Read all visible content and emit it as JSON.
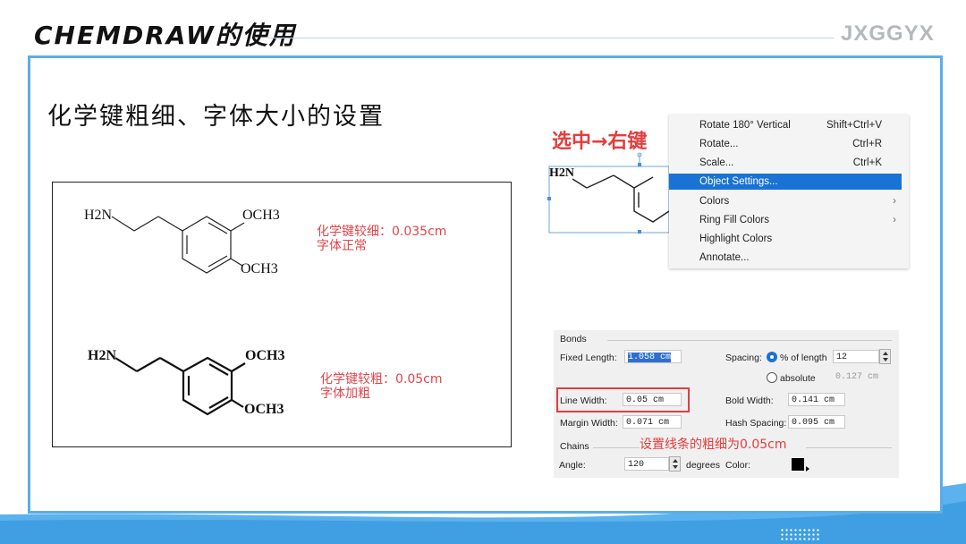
{
  "header": {
    "title": "CHEMDRAW的使用",
    "brand": "JXGGYX"
  },
  "slide": {
    "subtitle": "化学键粗细、字体大小的设置"
  },
  "molecules": {
    "top": {
      "amine": "H2N",
      "ome_upper": "OCH3",
      "ome_lower": "OCH3",
      "note_line1": "化学键较细：0.035cm",
      "note_line2": "字体正常"
    },
    "bottom": {
      "amine": "H2N",
      "ome_upper": "OCH3",
      "ome_lower": "OCH3",
      "note_line1": "化学键较粗：0.05cm",
      "note_line2": "字体加粗"
    }
  },
  "context_menu": {
    "annotation": "选中→右键",
    "fragment_label": "H2N",
    "items": [
      {
        "label": "Rotate 180° Vertical",
        "shortcut": "Shift+Ctrl+V",
        "arrow": ""
      },
      {
        "label": "Rotate...",
        "shortcut": "Ctrl+R",
        "arrow": ""
      },
      {
        "label": "Scale...",
        "shortcut": "Ctrl+K",
        "arrow": ""
      },
      {
        "label": "Object Settings...",
        "shortcut": "",
        "arrow": ""
      },
      {
        "label": "Colors",
        "shortcut": "",
        "arrow": "›"
      },
      {
        "label": "Ring Fill Colors",
        "shortcut": "",
        "arrow": "›"
      },
      {
        "label": "Highlight Colors",
        "shortcut": "",
        "arrow": ""
      },
      {
        "label": "Annotate...",
        "shortcut": "",
        "arrow": ""
      }
    ],
    "highlighted_index": 3
  },
  "bonds_dialog": {
    "group_bonds": "Bonds",
    "fixed_length_label": "Fixed Length:",
    "fixed_length_value": "1.058 cm",
    "spacing_label": "Spacing:",
    "spacing_option_percent": "% of length",
    "spacing_percent_value": "12",
    "spacing_option_absolute": "absolute",
    "spacing_absolute_value": "0.127 cm",
    "line_width_label": "Line Width:",
    "line_width_value": "0.05 cm",
    "bold_width_label": "Bold Width:",
    "bold_width_value": "0.141 cm",
    "margin_width_label": "Margin Width:",
    "margin_width_value": "0.071 cm",
    "hash_spacing_label": "Hash Spacing:",
    "hash_spacing_value": "0.095 cm",
    "group_chains": "Chains",
    "angle_label": "Angle:",
    "angle_value": "120",
    "degrees_label": "degrees",
    "color_label": "Color:",
    "note": "设置线条的粗细为0.05cm"
  },
  "colors": {
    "accent_blue": "#5aaee8",
    "annotation_red": "#e53c3c",
    "menu_highlight": "#1a73d4"
  }
}
